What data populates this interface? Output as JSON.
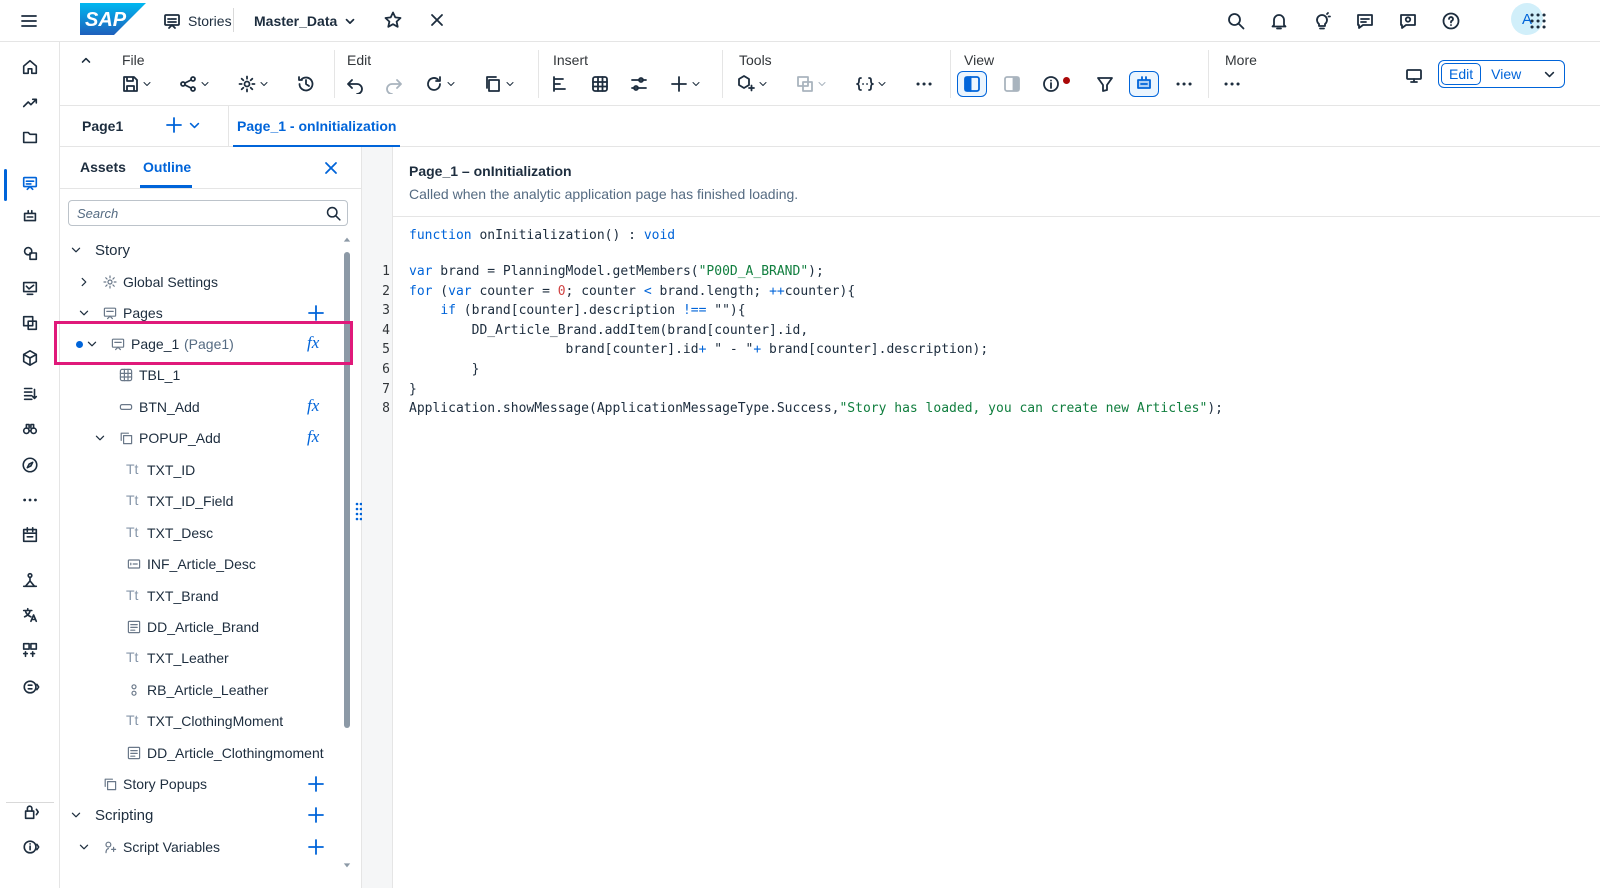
{
  "shell": {
    "stories_label": "Stories",
    "story_name": "Master_Data",
    "avatar_letter": "A"
  },
  "toolbar": {
    "groups": {
      "file": "File",
      "edit": "Edit",
      "insert": "Insert",
      "tools": "Tools",
      "view": "View",
      "more": "More"
    },
    "edit_label": "Edit",
    "view_label": "View"
  },
  "tabs": {
    "page": "Page1",
    "script": "Page_1 - onInitialization"
  },
  "panel": {
    "assets_tab": "Assets",
    "outline_tab": "Outline",
    "search_placeholder": "Search"
  },
  "tree": {
    "story": "Story",
    "global_settings": "Global Settings",
    "pages": "Pages",
    "page_1": "Page_1",
    "page_1_alias": "(Page1)",
    "tbl_1": "TBL_1",
    "btn_add": "BTN_Add",
    "popup_add": "POPUP_Add",
    "popup_children": [
      {
        "label": "TXT_ID",
        "icon": "text"
      },
      {
        "label": "TXT_ID_Field",
        "icon": "text"
      },
      {
        "label": "TXT_Desc",
        "icon": "text"
      },
      {
        "label": "INF_Article_Desc",
        "icon": "input"
      },
      {
        "label": "TXT_Brand",
        "icon": "text"
      },
      {
        "label": "DD_Article_Brand",
        "icon": "dropdown"
      },
      {
        "label": "TXT_Leather",
        "icon": "text"
      },
      {
        "label": "RB_Article_Leather",
        "icon": "radio"
      },
      {
        "label": "TXT_ClothingMoment",
        "icon": "text"
      },
      {
        "label": "DD_Article_Clothingmoment",
        "icon": "dropdown"
      }
    ],
    "story_popups": "Story Popups",
    "scripting": "Scripting",
    "script_variables": "Script Variables",
    "text_glyph": "Tt",
    "fx_glyph": "fx"
  },
  "editor": {
    "event_title": "Page_1 – onInitialization",
    "event_desc": "Called when the analytic application page has finished loading.",
    "signature": {
      "kw_function": "function",
      "name": " onInitialization() : ",
      "kw_void": "void"
    },
    "lines": [
      {
        "n": "1",
        "tokens": [
          [
            "kw",
            "var"
          ],
          [
            "p",
            " brand = PlanningModel.getMembers("
          ],
          [
            "s",
            "\"P00D_A_BRAND\""
          ],
          [
            "p",
            ");"
          ]
        ]
      },
      {
        "n": "2",
        "tokens": [
          [
            "kw",
            "for"
          ],
          [
            "p",
            " ("
          ],
          [
            "kw",
            "var"
          ],
          [
            "p",
            " counter = "
          ],
          [
            "num",
            "0"
          ],
          [
            "p",
            "; counter "
          ],
          [
            "kw",
            "<"
          ],
          [
            "p",
            " brand.length; "
          ],
          [
            "kw",
            "++"
          ],
          [
            "p",
            "counter){"
          ]
        ]
      },
      {
        "n": "3",
        "tokens": [
          [
            "p",
            "    "
          ],
          [
            "kw",
            "if"
          ],
          [
            "p",
            " (brand[counter].description "
          ],
          [
            "kw",
            "!=="
          ],
          [
            "p",
            " \"\"){"
          ]
        ]
      },
      {
        "n": "4",
        "tokens": [
          [
            "p",
            "        DD_Article_Brand.addItem(brand[counter].id,"
          ]
        ]
      },
      {
        "n": "5",
        "tokens": [
          [
            "p",
            "                    brand[counter].id"
          ],
          [
            "kw",
            "+"
          ],
          [
            "p",
            " \" - \""
          ],
          [
            "kw",
            "+"
          ],
          [
            "p",
            " brand[counter].description);"
          ]
        ]
      },
      {
        "n": "6",
        "tokens": [
          [
            "p",
            "        }"
          ]
        ]
      },
      {
        "n": "7",
        "tokens": [
          [
            "p",
            "}"
          ]
        ]
      },
      {
        "n": "8",
        "tokens": [
          [
            "p",
            "Application.showMessage(ApplicationMessageType.Success,"
          ],
          [
            "s",
            "\"Story has loaded, you can create new Articles\""
          ],
          [
            "p",
            ");"
          ]
        ]
      }
    ]
  },
  "colors": {
    "accent": "#0064d9",
    "highlight": "#e0197a",
    "string": "#107e3e",
    "number": "#d04343",
    "sap_blue": "#0a6ed1"
  }
}
